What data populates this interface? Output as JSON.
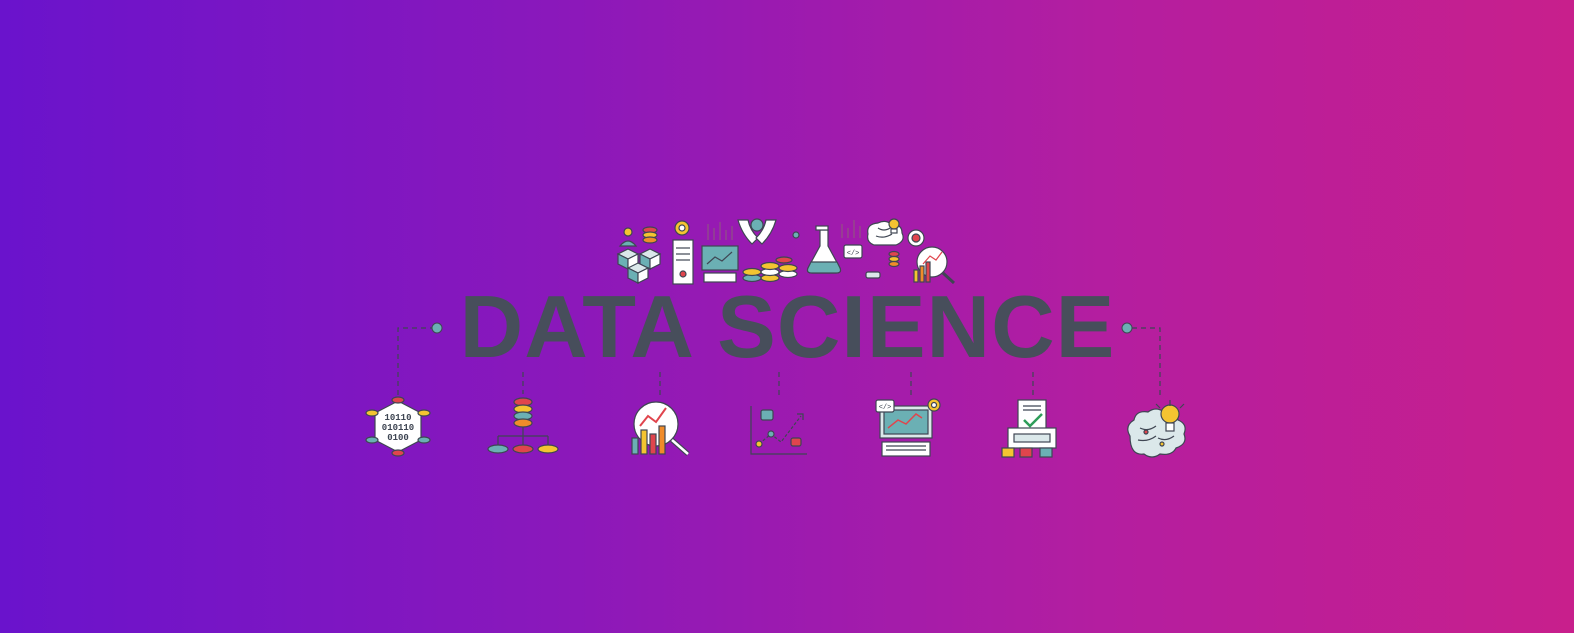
{
  "banner": {
    "title": "DATA SCIENCE",
    "colors": {
      "gradient_start": "#6a13cc",
      "gradient_end": "#c81f8c",
      "title": "#474e5b",
      "outline": "#3f4653",
      "teal": "#6bb0b4",
      "red": "#e0454d",
      "yellow": "#f4c431",
      "orange": "#f08c2a"
    },
    "binary_lines": [
      "10110",
      "010110",
      "0100"
    ],
    "code_tag": "</>",
    "top_icons": [
      "user-icon",
      "database-icon",
      "gear-icon",
      "server-icon",
      "monitor-chart-icon",
      "hands-ai-icon",
      "coins-stack-icon",
      "flask-icon",
      "code-bubble-icon",
      "brain-icon",
      "lightbulb-icon",
      "target-icon",
      "magnifier-chart-icon"
    ],
    "bottom_icons": [
      "binary-hexagon-icon",
      "database-network-icon",
      "magnifier-chart-icon",
      "line-chart-icon",
      "monitor-analytics-icon",
      "printer-report-icon",
      "brain-lightbulb-icon"
    ]
  }
}
